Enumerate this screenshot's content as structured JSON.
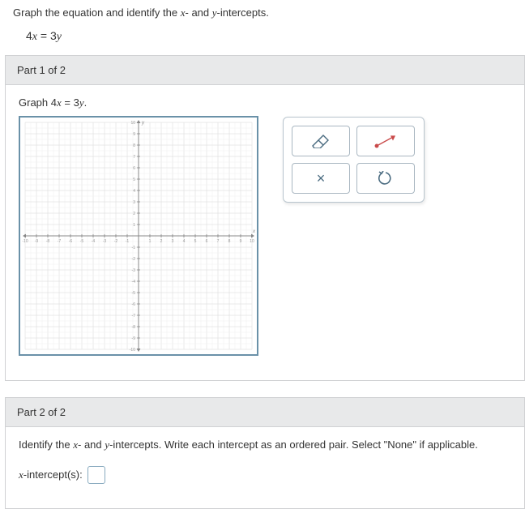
{
  "instruction_pre": "Graph the equation and identify the ",
  "instruction_x": "x",
  "instruction_mid": "- and ",
  "instruction_y": "y",
  "instruction_post": "-intercepts.",
  "equation": "4x = 3y",
  "equation_lhs": "4",
  "equation_x": "x",
  "equation_eq": " = 3",
  "equation_y": "y",
  "part1": {
    "header": "Part 1 of 2",
    "instruction_pre": "Graph 4",
    "instruction_x": "x",
    "instruction_mid": " = 3",
    "instruction_y": "y",
    "instruction_post": "."
  },
  "part2": {
    "header": "Part 2 of 2",
    "text_pre": "Identify the ",
    "text_x": "x",
    "text_mid": "- and ",
    "text_y": "y",
    "text_post": "-intercepts. Write each intercept as an ordered pair. Select \"None\" if applicable.",
    "intercept_x": "x",
    "intercept_label": "-intercept(s):"
  },
  "chart_data": {
    "type": "scatter",
    "title": "",
    "xlabel": "x",
    "ylabel": "y",
    "xlim": [
      -10,
      10
    ],
    "ylim": [
      -10,
      10
    ],
    "xticks": [
      -10,
      -9,
      -8,
      -7,
      -6,
      -5,
      -4,
      -3,
      -2,
      -1,
      1,
      2,
      3,
      4,
      5,
      6,
      7,
      8,
      9,
      10
    ],
    "yticks": [
      -10,
      -9,
      -8,
      -7,
      -6,
      -5,
      -4,
      -3,
      -2,
      -1,
      1,
      2,
      3,
      4,
      5,
      6,
      7,
      8,
      9,
      10
    ],
    "series": []
  },
  "tools": {
    "eraser": "eraser",
    "line": "line",
    "clear": "×",
    "undo": "↺"
  }
}
